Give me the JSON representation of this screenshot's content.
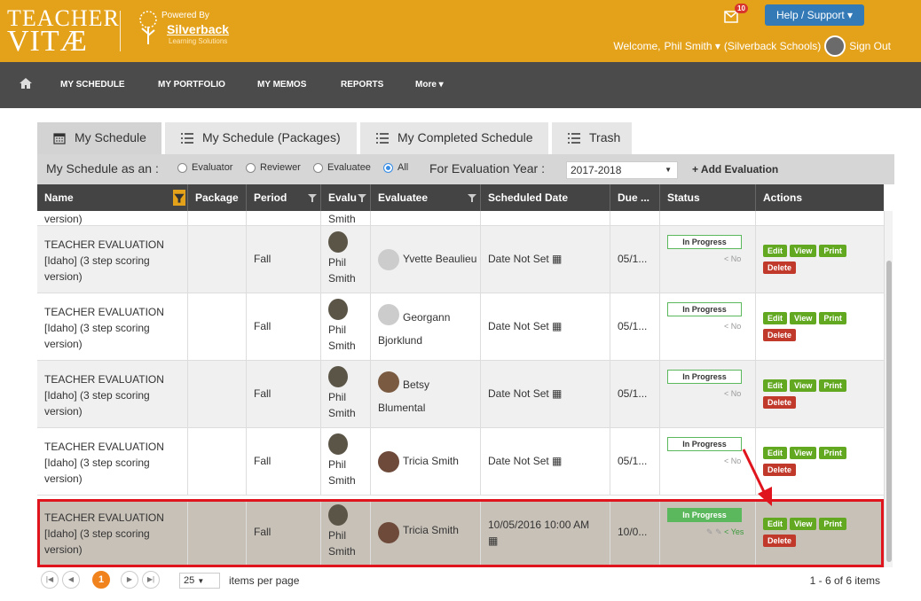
{
  "brand": {
    "line1": "TEACHER",
    "line2": "VITÆ",
    "powered_by": "Powered By",
    "partner": "Silverback",
    "partner_sub": "Learning Solutions"
  },
  "header": {
    "mail_count": "10",
    "help_label": "Help / Support",
    "welcome": "Welcome,",
    "user": "Phil Smith",
    "org": "(Silverback Schools)",
    "sign_out": "Sign Out"
  },
  "nav": [
    "MY SCHEDULE",
    "MY PORTFOLIO",
    "MY MEMOS",
    "REPORTS",
    "More"
  ],
  "tabs": [
    "My Schedule",
    "My Schedule (Packages)",
    "My Completed Schedule",
    "Trash"
  ],
  "filter": {
    "label": "My Schedule as an :",
    "roles": [
      "Evaluator",
      "Reviewer",
      "Evaluatee",
      "All"
    ],
    "year_label": "For Evaluation Year :",
    "year": "2017-2018",
    "add": "+ Add Evaluation"
  },
  "columns": [
    "Name",
    "Package",
    "Period",
    "Evalu",
    "Evaluatee",
    "Scheduled Date",
    "Due ...",
    "Status",
    "Actions"
  ],
  "partial_row": {
    "name_tail": "version)",
    "evaluator_tail": "Smith"
  },
  "rows": [
    {
      "name": "TEACHER EVALUATION [Idaho] (3 step scoring version)",
      "period": "Fall",
      "evaluator": "Phil Smith",
      "evaluatee": "Yvette Beaulieu",
      "date": "Date Not Set",
      "due": "05/1...",
      "status": "In Progress",
      "share": "No"
    },
    {
      "name": "TEACHER EVALUATION [Idaho] (3 step scoring version)",
      "period": "Fall",
      "evaluator": "Phil Smith",
      "evaluatee": "Georgann Bjorklund",
      "date": "Date Not Set",
      "due": "05/1...",
      "status": "In Progress",
      "share": "No"
    },
    {
      "name": "TEACHER EVALUATION [Idaho] (3 step scoring version)",
      "period": "Fall",
      "evaluator": "Phil Smith",
      "evaluatee": "Betsy Blumental",
      "date": "Date Not Set",
      "due": "05/1...",
      "status": "In Progress",
      "share": "No"
    },
    {
      "name": "TEACHER EVALUATION [Idaho] (3 step scoring version)",
      "period": "Fall",
      "evaluator": "Phil Smith",
      "evaluatee": "Tricia Smith",
      "date": "Date Not Set",
      "due": "05/1...",
      "status": "In Progress",
      "share": "No"
    },
    {
      "name": "TEACHER EVALUATION [Idaho] (3 step scoring version)",
      "period": "Fall",
      "evaluator": "Phil Smith",
      "evaluatee": "Tricia Smith",
      "date": "10/05/2016 10:00 AM",
      "due": "10/0...",
      "status": "In Progress",
      "share": "Yes"
    }
  ],
  "actions": {
    "edit": "Edit",
    "view": "View",
    "print": "Print",
    "delete": "Delete"
  },
  "pager": {
    "current": "1",
    "per_page": "25",
    "per_page_label": "items per page",
    "summary": "1 - 6 of 6 items"
  }
}
